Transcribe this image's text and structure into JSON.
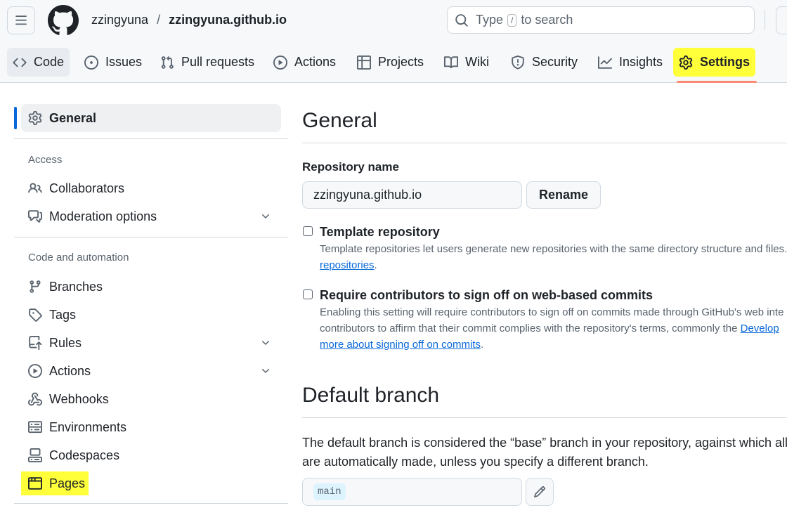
{
  "header": {
    "owner": "zzingyuna",
    "separator": "/",
    "repo": "zzingyuna.github.io",
    "search": {
      "prefix": "Type",
      "key": "/",
      "suffix": "to search"
    }
  },
  "tabs": [
    {
      "label": "Code",
      "icon": "code-icon"
    },
    {
      "label": "Issues",
      "icon": "issue-icon"
    },
    {
      "label": "Pull requests",
      "icon": "pull-request-icon"
    },
    {
      "label": "Actions",
      "icon": "play-icon"
    },
    {
      "label": "Projects",
      "icon": "table-icon"
    },
    {
      "label": "Wiki",
      "icon": "book-icon"
    },
    {
      "label": "Security",
      "icon": "shield-icon"
    },
    {
      "label": "Insights",
      "icon": "graph-icon"
    },
    {
      "label": "Settings",
      "icon": "gear-icon",
      "selected": true
    }
  ],
  "sidebar": {
    "general": "General",
    "access_heading": "Access",
    "collaborators": "Collaborators",
    "moderation": "Moderation options",
    "code_heading": "Code and automation",
    "branches": "Branches",
    "tags": "Tags",
    "rules": "Rules",
    "actions": "Actions",
    "webhooks": "Webhooks",
    "environments": "Environments",
    "codespaces": "Codespaces",
    "pages": "Pages"
  },
  "main": {
    "title": "General",
    "repo_name_label": "Repository name",
    "repo_name_value": "zzingyuna.github.io",
    "rename_button": "Rename",
    "template": {
      "title": "Template repository",
      "desc": "Template repositories let users generate new repositories with the same directory structure and files.",
      "link": "repositories",
      "after_link": "."
    },
    "signoff": {
      "title": "Require contributors to sign off on web-based commits",
      "line1": "Enabling this setting will require contributors to sign off on commits made through GitHub's web inte",
      "line2_text": "contributors to affirm that their commit complies with the repository's terms, commonly the ",
      "line2_link": "Develop",
      "line3_link": "more about signing off on commits",
      "line3_after": "."
    },
    "default_branch": {
      "title": "Default branch",
      "line1": "The default branch is considered the “base” branch in your repository, against which all pu",
      "line2": "are automatically made, unless you specify a different branch.",
      "branch": "main"
    }
  },
  "colors": {
    "highlight": "#ffff3a",
    "link": "#0969da",
    "active_bar": "#0969da",
    "tab_underline": "#fd8c73"
  }
}
